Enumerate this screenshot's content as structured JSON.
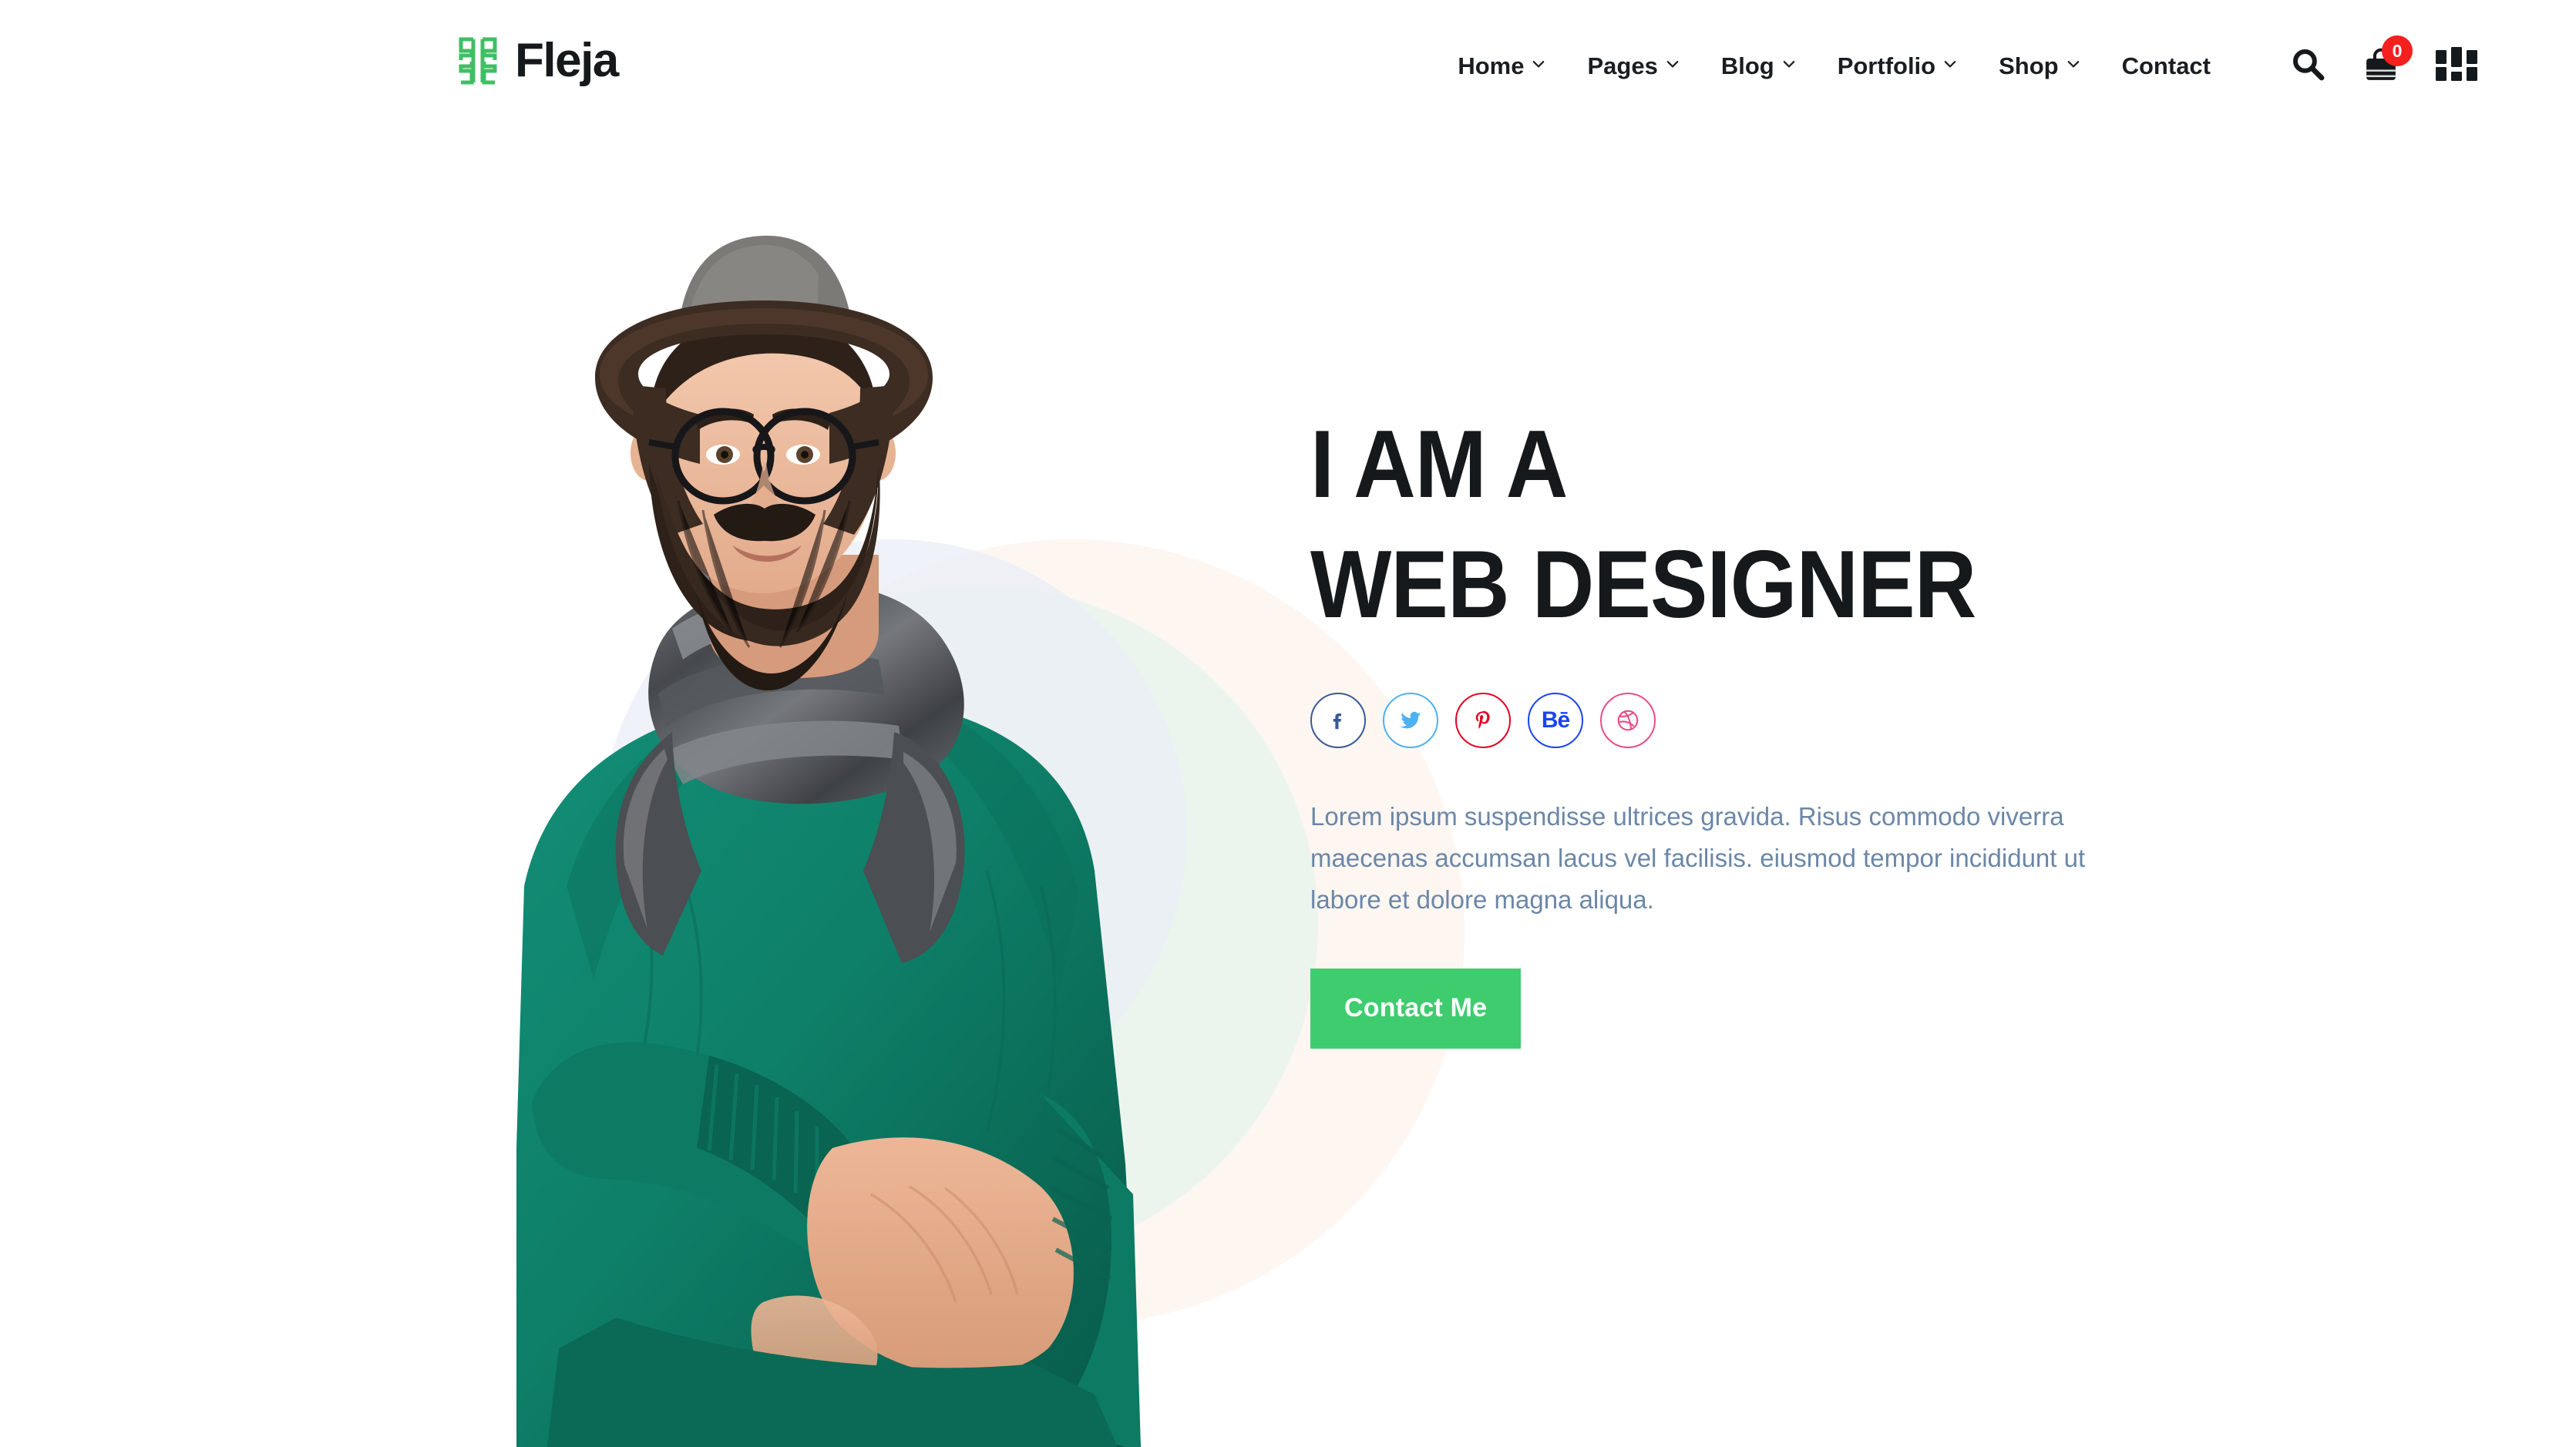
{
  "brand": {
    "name": "Fleja",
    "logo_icon": "fleja-bracket-logo-icon",
    "logo_color": "#3fbf63"
  },
  "nav": {
    "items": [
      {
        "label": "Home",
        "has_dropdown": true,
        "icon": "chevron-down-icon"
      },
      {
        "label": "Pages",
        "has_dropdown": true,
        "icon": "chevron-down-icon"
      },
      {
        "label": "Blog",
        "has_dropdown": true,
        "icon": "chevron-down-icon"
      },
      {
        "label": "Portfolio",
        "has_dropdown": true,
        "icon": "chevron-down-icon"
      },
      {
        "label": "Shop",
        "has_dropdown": true,
        "icon": "chevron-down-icon"
      },
      {
        "label": "Contact",
        "has_dropdown": false,
        "icon": ""
      }
    ],
    "tools": {
      "search_icon": "search-icon",
      "cart_icon": "shopping-bag-icon",
      "cart_count": "0",
      "cart_badge_color": "#f41f1f",
      "grid_icon": "grid-menu-icon"
    }
  },
  "hero": {
    "headline_line1": "I AM A",
    "headline_line2": "WEB DESIGNER",
    "headline_color": "#16191c",
    "paragraph": "Lorem ipsum suspendisse ultrices gravida. Risus commodo viverra maecenas accumsan lacus vel facilisis. eiusmod tempor incididunt ut labore et dolore magna aliqua.",
    "paragraph_color": "#6b87a8",
    "cta_label": "Contact Me",
    "cta_color": "#3fcc6e",
    "portrait_alt": "bearded-man-with-hat-and-glasses-in-green-sweater",
    "socials": [
      {
        "name": "Facebook",
        "icon": "facebook-icon",
        "color": "#3b5998",
        "glyph": "f"
      },
      {
        "name": "Twitter",
        "icon": "twitter-icon",
        "color": "#4db2f0",
        "glyph": ""
      },
      {
        "name": "Pinterest",
        "icon": "pinterest-icon",
        "color": "#e60023",
        "glyph": "P"
      },
      {
        "name": "Behance",
        "icon": "behance-icon",
        "color": "#1a44f2",
        "glyph": "Bē"
      },
      {
        "name": "Dribbble",
        "icon": "dribbble-icon",
        "color": "#ea4c89",
        "glyph": ""
      }
    ]
  },
  "decor": {
    "circle_cream": "#fdf5ee",
    "circle_green": "#eaf5ec",
    "circle_blue": "#eaeef5"
  }
}
